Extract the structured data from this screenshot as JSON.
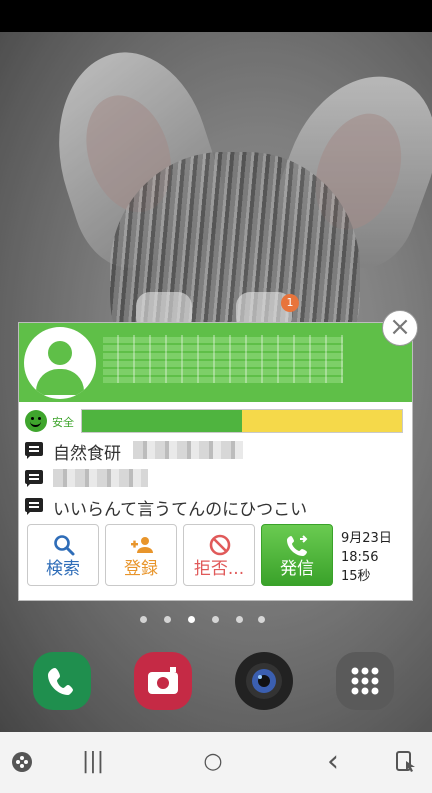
{
  "popup": {
    "close_label": "×",
    "safety_label": "安全",
    "safety_score": 0.5,
    "info_lines": [
      {
        "text": "自然食研"
      },
      {
        "text": ""
      },
      {
        "text": "いいらんて言うてんのにひつこい"
      }
    ],
    "buttons": {
      "search": "検索",
      "register": "登録",
      "reject": "拒否...",
      "call": "発信"
    },
    "call_info": {
      "date": "9月23日",
      "time": "18:56",
      "duration": "15秒"
    }
  },
  "badge_count": "1",
  "colors": {
    "header_green": "#5fbf48",
    "safety_green": "#4fb43f",
    "safety_yellow": "#f5d94a",
    "search_blue": "#2f6db8",
    "register_orange": "#e8952b",
    "reject_red": "#e05a5a"
  },
  "icons": {
    "avatar": "person-icon",
    "close": "close-icon",
    "smile": "smile-face-icon",
    "message": "message-icon",
    "search": "search-icon",
    "register": "add-user-icon",
    "reject": "block-icon",
    "call": "phone-forward-icon",
    "dock": [
      "phone-icon",
      "camera-app-icon",
      "camera-lens-icon",
      "apps-grid-icon"
    ],
    "navbar": [
      "game-controller-icon",
      "recents-icon",
      "home-icon",
      "back-icon",
      "screen-touch-icon"
    ]
  },
  "navbar": {
    "recents": "|||",
    "home": "○",
    "back": "‹"
  }
}
